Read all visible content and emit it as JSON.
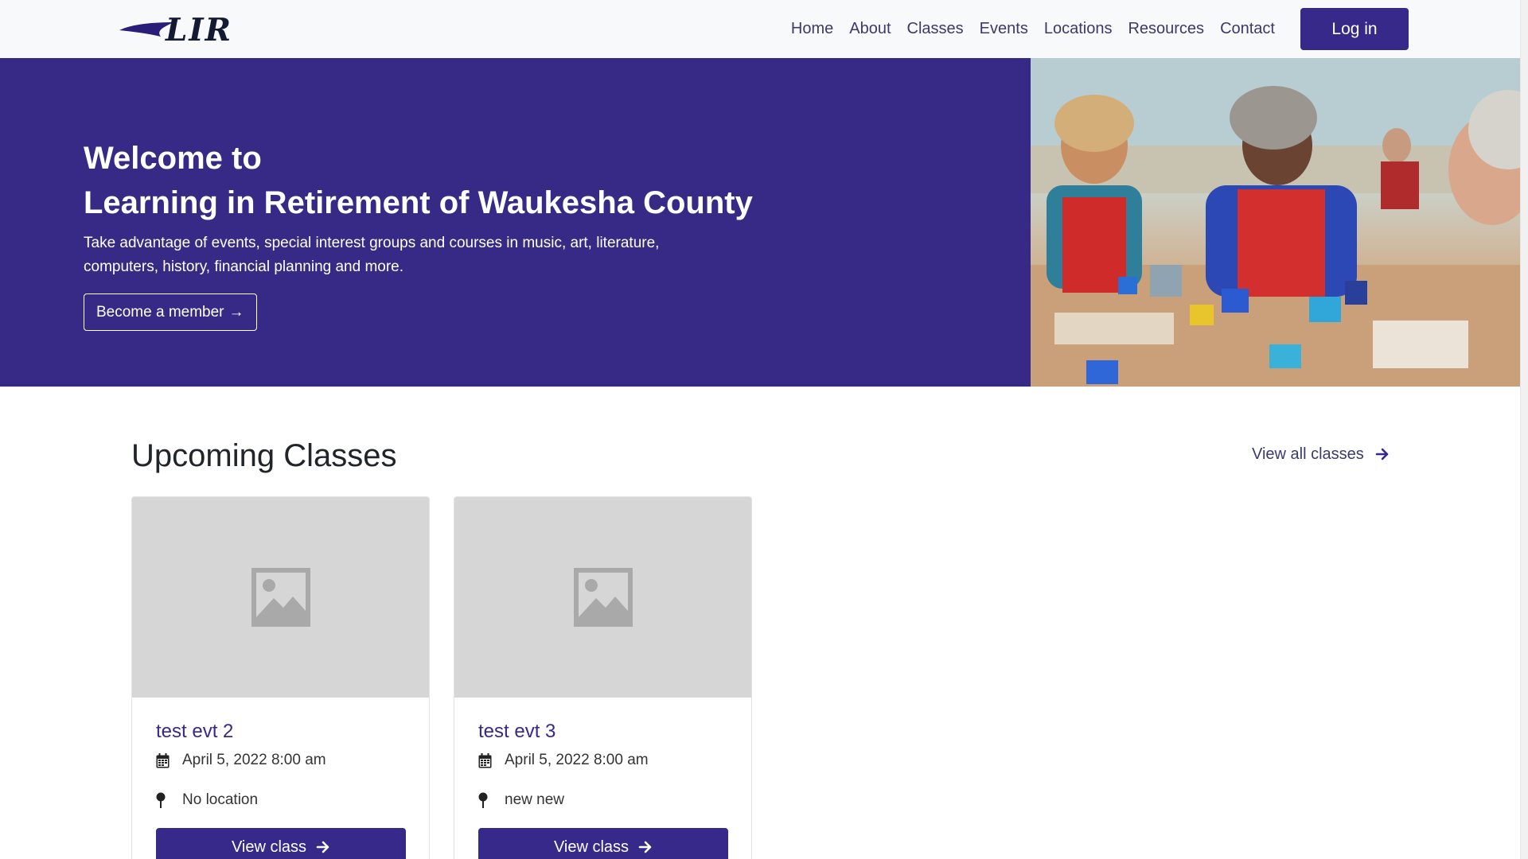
{
  "brand": {
    "logo_text": "LIR"
  },
  "nav": {
    "links": [
      "Home",
      "About",
      "Classes",
      "Events",
      "Locations",
      "Resources",
      "Contact"
    ],
    "login_label": "Log in"
  },
  "hero": {
    "line1": "Welcome to",
    "line2": "Learning in Retirement of Waukesha County",
    "description": "Take advantage of events, special interest groups and courses in music, art, literature, computers, history, financial planning and more.",
    "cta_label": "Become a member",
    "cta_arrow": "→"
  },
  "upcoming": {
    "title": "Upcoming Classes",
    "view_all_label": "View all classes",
    "cards": [
      {
        "title": "test evt 2",
        "date": "April 5, 2022 8:00 am",
        "location": "No location",
        "button_label": "View class"
      },
      {
        "title": "test evt 3",
        "date": "April 5, 2022 8:00 am",
        "location": "new new",
        "button_label": "View class"
      }
    ]
  },
  "colors": {
    "primary": "#37298a",
    "navbar_bg": "#f8f9fa",
    "placeholder_bg": "#d6d6d6",
    "nav_text": "#3b3a6b"
  },
  "icons": {
    "card_image": "image-placeholder-icon",
    "date": "calendar-icon",
    "location": "map-pin-icon",
    "arrow": "arrow-right-icon"
  }
}
